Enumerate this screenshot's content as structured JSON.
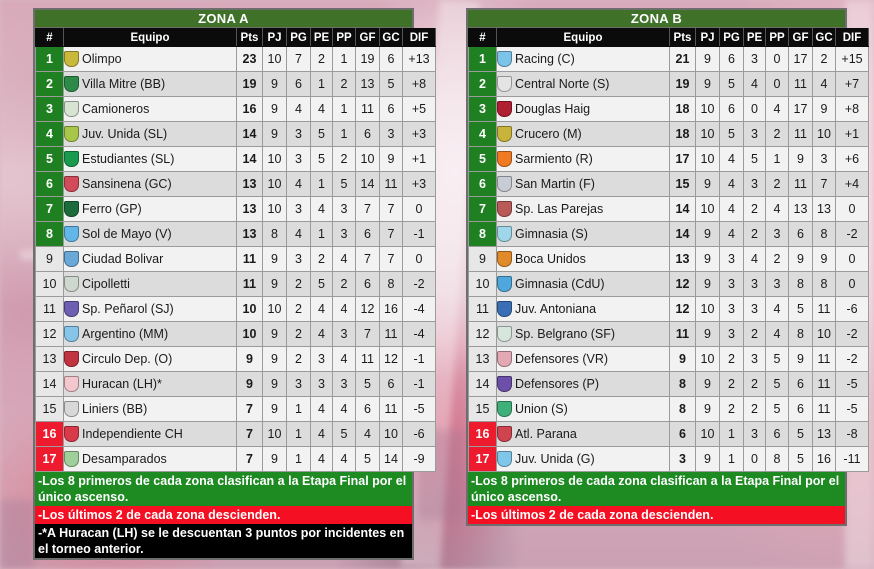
{
  "colors": {
    "qualify_green": "#1f8022",
    "relegate_red": "#ee1b2e",
    "zone_header_green": "#3f7228",
    "header_black": "#0b0b0b",
    "note_green": "#1d8a22",
    "note_red": "#f50f23",
    "note_black": "#000000"
  },
  "columns": [
    "#",
    "Equipo",
    "Pts",
    "PJ",
    "PG",
    "PE",
    "PP",
    "GF",
    "GC",
    "DIF"
  ],
  "zoneA": {
    "title": "ZONA A",
    "rows": [
      {
        "pos": "1",
        "team": "Olimpo",
        "pts": "23",
        "pj": "10",
        "pg": "7",
        "pe": "2",
        "pp": "1",
        "gf": "19",
        "gc": "6",
        "dif": "+13",
        "state": "qualify",
        "crest": "#c9b93a"
      },
      {
        "pos": "2",
        "team": "Villa Mitre (BB)",
        "pts": "19",
        "pj": "9",
        "pg": "6",
        "pe": "1",
        "pp": "2",
        "gf": "13",
        "gc": "5",
        "dif": "+8",
        "state": "qualify",
        "crest": "#2f8a4a"
      },
      {
        "pos": "3",
        "team": "Camioneros",
        "pts": "16",
        "pj": "9",
        "pg": "4",
        "pe": "4",
        "pp": "1",
        "gf": "11",
        "gc": "6",
        "dif": "+5",
        "state": "qualify",
        "crest": "#d7e4d2"
      },
      {
        "pos": "4",
        "team": "Juv. Unida (SL)",
        "pts": "14",
        "pj": "9",
        "pg": "3",
        "pe": "5",
        "pp": "1",
        "gf": "6",
        "gc": "3",
        "dif": "+3",
        "state": "qualify",
        "crest": "#a8c64a"
      },
      {
        "pos": "5",
        "team": "Estudiantes (SL)",
        "pts": "14",
        "pj": "10",
        "pg": "3",
        "pe": "5",
        "pp": "2",
        "gf": "10",
        "gc": "9",
        "dif": "+1",
        "state": "qualify",
        "crest": "#199a4e"
      },
      {
        "pos": "6",
        "team": "Sansinena (GC)",
        "pts": "13",
        "pj": "10",
        "pg": "4",
        "pe": "1",
        "pp": "5",
        "gf": "14",
        "gc": "11",
        "dif": "+3",
        "state": "qualify",
        "crest": "#d24b5a"
      },
      {
        "pos": "7",
        "team": "Ferro (GP)",
        "pts": "13",
        "pj": "10",
        "pg": "3",
        "pe": "4",
        "pp": "3",
        "gf": "7",
        "gc": "7",
        "dif": "0",
        "state": "qualify",
        "crest": "#1d6b3a"
      },
      {
        "pos": "8",
        "team": "Sol de Mayo (V)",
        "pts": "13",
        "pj": "8",
        "pg": "4",
        "pe": "1",
        "pp": "3",
        "gf": "6",
        "gc": "7",
        "dif": "-1",
        "state": "qualify",
        "crest": "#63b6e8"
      },
      {
        "pos": "9",
        "team": "Ciudad Bolivar",
        "pts": "11",
        "pj": "9",
        "pg": "3",
        "pe": "2",
        "pp": "4",
        "gf": "7",
        "gc": "7",
        "dif": "0",
        "state": "normal",
        "crest": "#6aa8d8"
      },
      {
        "pos": "10",
        "team": "Cipolletti",
        "pts": "11",
        "pj": "9",
        "pg": "2",
        "pe": "5",
        "pp": "2",
        "gf": "6",
        "gc": "8",
        "dif": "-2",
        "state": "normal",
        "crest": "#cfd8cf"
      },
      {
        "pos": "11",
        "team": "Sp. Peñarol (SJ)",
        "pts": "10",
        "pj": "10",
        "pg": "2",
        "pe": "4",
        "pp": "4",
        "gf": "12",
        "gc": "16",
        "dif": "-4",
        "state": "normal",
        "crest": "#6f5fb0"
      },
      {
        "pos": "12",
        "team": "Argentino (MM)",
        "pts": "10",
        "pj": "9",
        "pg": "2",
        "pe": "4",
        "pp": "3",
        "gf": "7",
        "gc": "11",
        "dif": "-4",
        "state": "normal",
        "crest": "#86c4e8"
      },
      {
        "pos": "13",
        "team": "Circulo Dep. (O)",
        "pts": "9",
        "pj": "9",
        "pg": "2",
        "pe": "3",
        "pp": "4",
        "gf": "11",
        "gc": "12",
        "dif": "-1",
        "state": "normal",
        "crest": "#c23340"
      },
      {
        "pos": "14",
        "team": "Huracan (LH)*",
        "pts": "9",
        "pj": "9",
        "pg": "3",
        "pe": "3",
        "pp": "3",
        "gf": "5",
        "gc": "6",
        "dif": "-1",
        "state": "normal",
        "crest": "#f3c7cd"
      },
      {
        "pos": "15",
        "team": "Liniers (BB)",
        "pts": "7",
        "pj": "9",
        "pg": "1",
        "pe": "4",
        "pp": "4",
        "gf": "6",
        "gc": "11",
        "dif": "-5",
        "state": "normal",
        "crest": "#d8d8d8"
      },
      {
        "pos": "16",
        "team": "Independiente CH",
        "pts": "7",
        "pj": "10",
        "pg": "1",
        "pe": "4",
        "pp": "5",
        "gf": "4",
        "gc": "10",
        "dif": "-6",
        "state": "relegate",
        "crest": "#d83a4a"
      },
      {
        "pos": "17",
        "team": "Desamparados",
        "pts": "7",
        "pj": "9",
        "pg": "1",
        "pe": "4",
        "pp": "4",
        "gf": "5",
        "gc": "14",
        "dif": "-9",
        "state": "relegate",
        "crest": "#9fcf9a"
      }
    ],
    "notes": [
      {
        "text": "-Los 8 primeros de cada zona clasifican a la Etapa Final por el único ascenso.",
        "style": "green"
      },
      {
        "text": "-Los últimos 2 de cada zona descienden.",
        "style": "red"
      },
      {
        "text": "-*A Huracan (LH) se le descuentan 3 puntos por incidentes en el torneo anterior.",
        "style": "black"
      }
    ]
  },
  "zoneB": {
    "title": "ZONA B",
    "rows": [
      {
        "pos": "1",
        "team": "Racing (C)",
        "pts": "21",
        "pj": "9",
        "pg": "6",
        "pe": "3",
        "pp": "0",
        "gf": "17",
        "gc": "2",
        "dif": "+15",
        "state": "qualify",
        "crest": "#7cc3e8"
      },
      {
        "pos": "2",
        "team": "Central Norte (S)",
        "pts": "19",
        "pj": "9",
        "pg": "5",
        "pe": "4",
        "pp": "0",
        "gf": "11",
        "gc": "4",
        "dif": "+7",
        "state": "qualify",
        "crest": "#e4e4e4"
      },
      {
        "pos": "3",
        "team": "Douglas Haig",
        "pts": "18",
        "pj": "10",
        "pg": "6",
        "pe": "0",
        "pp": "4",
        "gf": "17",
        "gc": "9",
        "dif": "+8",
        "state": "qualify",
        "crest": "#b02030"
      },
      {
        "pos": "4",
        "team": "Crucero (M)",
        "pts": "18",
        "pj": "10",
        "pg": "5",
        "pe": "3",
        "pp": "2",
        "gf": "11",
        "gc": "10",
        "dif": "+1",
        "state": "qualify",
        "crest": "#c8b43a"
      },
      {
        "pos": "5",
        "team": "Sarmiento (R)",
        "pts": "17",
        "pj": "10",
        "pg": "4",
        "pe": "5",
        "pp": "1",
        "gf": "9",
        "gc": "3",
        "dif": "+6",
        "state": "qualify",
        "crest": "#f07a22"
      },
      {
        "pos": "6",
        "team": "San Martin (F)",
        "pts": "15",
        "pj": "9",
        "pg": "4",
        "pe": "3",
        "pp": "2",
        "gf": "11",
        "gc": "7",
        "dif": "+4",
        "state": "qualify",
        "crest": "#c8ccd4"
      },
      {
        "pos": "7",
        "team": "Sp. Las Parejas",
        "pts": "14",
        "pj": "10",
        "pg": "4",
        "pe": "2",
        "pp": "4",
        "gf": "13",
        "gc": "13",
        "dif": "0",
        "state": "qualify",
        "crest": "#b85a55"
      },
      {
        "pos": "8",
        "team": "Gimnasia (S)",
        "pts": "14",
        "pj": "9",
        "pg": "4",
        "pe": "2",
        "pp": "3",
        "gf": "6",
        "gc": "8",
        "dif": "-2",
        "state": "qualify",
        "crest": "#9fd6ea"
      },
      {
        "pos": "9",
        "team": "Boca Unidos",
        "pts": "13",
        "pj": "9",
        "pg": "3",
        "pe": "4",
        "pp": "2",
        "gf": "9",
        "gc": "9",
        "dif": "0",
        "state": "normal",
        "crest": "#e08a2a"
      },
      {
        "pos": "10",
        "team": "Gimnasia (CdU)",
        "pts": "12",
        "pj": "9",
        "pg": "3",
        "pe": "3",
        "pp": "3",
        "gf": "8",
        "gc": "8",
        "dif": "0",
        "state": "normal",
        "crest": "#4fa8dd"
      },
      {
        "pos": "11",
        "team": "Juv. Antoniana",
        "pts": "12",
        "pj": "10",
        "pg": "3",
        "pe": "3",
        "pp": "4",
        "gf": "5",
        "gc": "11",
        "dif": "-6",
        "state": "normal",
        "crest": "#3b6fb5"
      },
      {
        "pos": "12",
        "team": "Sp. Belgrano (SF)",
        "pts": "11",
        "pj": "9",
        "pg": "3",
        "pe": "2",
        "pp": "4",
        "gf": "8",
        "gc": "10",
        "dif": "-2",
        "state": "normal",
        "crest": "#d6e6dd"
      },
      {
        "pos": "13",
        "team": "Defensores (VR)",
        "pts": "9",
        "pj": "10",
        "pg": "2",
        "pe": "3",
        "pp": "5",
        "gf": "9",
        "gc": "11",
        "dif": "-2",
        "state": "normal",
        "crest": "#e2a8b4"
      },
      {
        "pos": "14",
        "team": "Defensores (P)",
        "pts": "8",
        "pj": "9",
        "pg": "2",
        "pe": "2",
        "pp": "5",
        "gf": "6",
        "gc": "11",
        "dif": "-5",
        "state": "normal",
        "crest": "#6b4fa8"
      },
      {
        "pos": "15",
        "team": "Union (S)",
        "pts": "8",
        "pj": "9",
        "pg": "2",
        "pe": "2",
        "pp": "5",
        "gf": "6",
        "gc": "11",
        "dif": "-5",
        "state": "normal",
        "crest": "#3fb07a"
      },
      {
        "pos": "16",
        "team": "Atl. Parana",
        "pts": "6",
        "pj": "10",
        "pg": "1",
        "pe": "3",
        "pp": "6",
        "gf": "5",
        "gc": "13",
        "dif": "-8",
        "state": "relegate",
        "crest": "#d0444f"
      },
      {
        "pos": "17",
        "team": "Juv. Unida (G)",
        "pts": "3",
        "pj": "9",
        "pg": "1",
        "pe": "0",
        "pp": "8",
        "gf": "5",
        "gc": "16",
        "dif": "-11",
        "state": "relegate",
        "crest": "#7fc6e8"
      }
    ],
    "notes": [
      {
        "text": "-Los 8 primeros de cada zona clasifican a la Etapa Final por el único ascenso.",
        "style": "green"
      },
      {
        "text": "-Los últimos 2 de cada zona descienden.",
        "style": "red"
      }
    ]
  }
}
